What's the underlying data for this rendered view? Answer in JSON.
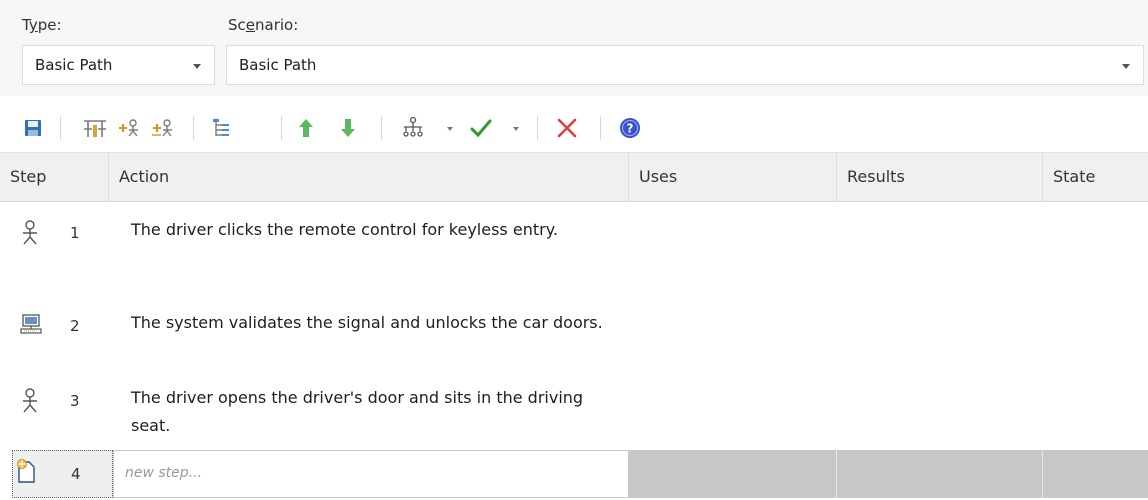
{
  "fields": {
    "type_label_pre": "T",
    "type_label_ul": "y",
    "type_label_post": "pe:",
    "type_value": "Basic Path",
    "scenario_label_pre": "Sc",
    "scenario_label_ul": "e",
    "scenario_label_post": "nario:",
    "scenario_value": "Basic Path"
  },
  "toolbar": {
    "icons": [
      "save-icon",
      "structure-icon",
      "add-actor-step-icon",
      "add-system-step-icon",
      "hierarchy-icon",
      "move-up-icon",
      "move-down-icon",
      "generate-diagram-icon",
      "validate-check-icon",
      "delete-icon",
      "help-icon"
    ],
    "colors": {
      "arrow": "#5cb85c",
      "check": "#2e9b2e",
      "delete": "#d9453b",
      "help": "#3b4fd1",
      "save": "#2f6fb5"
    }
  },
  "table": {
    "columns": [
      "Step",
      "Action",
      "Uses",
      "Results",
      "State"
    ],
    "rows": [
      {
        "step": "1",
        "actor": "actor-icon",
        "action": "The driver clicks the remote control for keyless entry."
      },
      {
        "step": "2",
        "actor": "computer-icon",
        "action": "The system validates the signal and unlocks the car doors."
      },
      {
        "step": "3",
        "actor": "actor-icon",
        "action": "The driver opens the driver's door and sits in the driving seat."
      }
    ],
    "new_row": {
      "step": "4",
      "placeholder": "new step..."
    }
  }
}
